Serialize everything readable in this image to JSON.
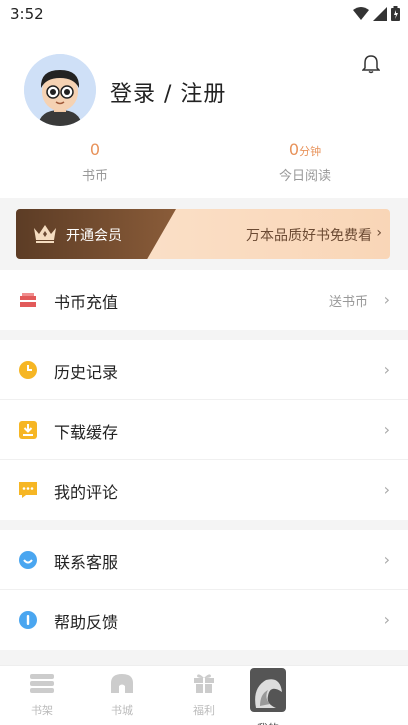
{
  "status_bar": {
    "time": "3:52"
  },
  "profile": {
    "login_text": "登录 / 注册",
    "stats": [
      {
        "value": "0",
        "unit": "",
        "label": "书币"
      },
      {
        "value": "0",
        "unit": "分钟",
        "label": "今日阅读"
      }
    ]
  },
  "vip_banner": {
    "open_label": "开通会员",
    "promo_text": "万本品质好书免费看",
    "promo_arrow": "›"
  },
  "menu": {
    "recharge": {
      "label": "书币充值",
      "extra": "送书币",
      "chevron": "›",
      "icon_color": "#e25a5a"
    },
    "history": {
      "label": "历史记录",
      "chevron": "›",
      "icon_color": "#f6b624"
    },
    "download": {
      "label": "下载缓存",
      "chevron": "›",
      "icon_color": "#f6b624"
    },
    "comments": {
      "label": "我的评论",
      "chevron": "›",
      "icon_color": "#f6b624"
    },
    "service": {
      "label": "联系客服",
      "chevron": "›",
      "icon_color": "#4aa6f0"
    },
    "feedback": {
      "label": "帮助反馈",
      "chevron": "›",
      "icon_color": "#4aa6f0"
    }
  },
  "tabs": [
    {
      "label": "书架",
      "icon": "bookshelf-icon"
    },
    {
      "label": "书城",
      "icon": "bookstore-icon"
    },
    {
      "label": "福利",
      "icon": "gift-icon"
    },
    {
      "label": "我的",
      "icon": "profile-icon"
    }
  ]
}
